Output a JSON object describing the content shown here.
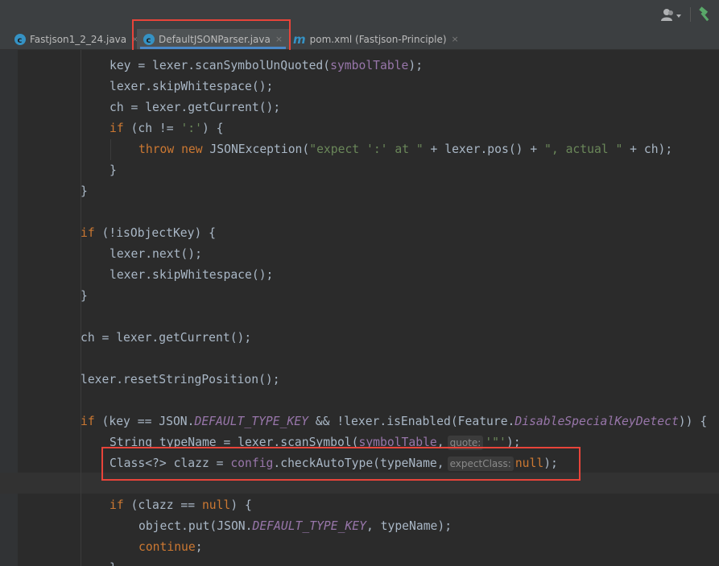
{
  "tabs": [
    {
      "label": "Fastjson1_2_24.java",
      "icon": "class-c-icon",
      "active": false
    },
    {
      "label": "DefaultJSONParser.java",
      "icon": "class-c-icon",
      "active": true
    },
    {
      "label": "pom.xml (Fastjson-Principle)",
      "icon": "maven-m-icon",
      "active": false
    }
  ],
  "close_glyph": "×",
  "toolbar": {
    "user_icon": "user-menu-icon",
    "build_icon": "hammer-icon"
  },
  "colors": {
    "background": "#2b2b2b",
    "keyword": "#cc7832",
    "string": "#6a8759",
    "field": "#9876aa",
    "default_text": "#a9b7c6",
    "highlight_box": "#e8443a",
    "active_tab_underline": "#4a88c7"
  },
  "code": {
    "l1": {
      "a": "key = lexer.scanSymbolUnQuoted(",
      "b": "symbolTable",
      "c": ");"
    },
    "l2": "lexer.skipWhitespace();",
    "l3": "ch = lexer.getCurrent();",
    "l4": {
      "kw": "if",
      "a": " (ch != ",
      "s": "':'",
      "b": ") {"
    },
    "l5": {
      "kw1": "throw",
      "kw2": "new",
      "a": " JSONException(",
      "s1": "\"expect ':' at \"",
      "b": " + lexer.pos() + ",
      "s2": "\", actual \"",
      "c": " + ch);"
    },
    "l6": "}",
    "l7": "}",
    "l8": {
      "kw": "if",
      "a": " (!isObjectKey) {"
    },
    "l9": "lexer.next();",
    "l10": "lexer.skipWhitespace();",
    "l11": "}",
    "l12": "ch = lexer.getCurrent();",
    "l13": "lexer.resetStringPosition();",
    "l14": {
      "kw": "if",
      "a": " (key == JSON.",
      "f": "DEFAULT_TYPE_KEY",
      "b": " && !lexer.isEnabled(Feature.",
      "f2": "DisableSpecialKeyDetect",
      "c": ")) {"
    },
    "l15": {
      "a": "String typeName = lexer.scanSymbol(",
      "f": "symbolTable",
      "b": ",",
      "hint": "quote:",
      "s": "'\"'",
      "c": ");"
    },
    "l16": {
      "a": "Class<?> clazz = ",
      "f": "config",
      "b": ".checkAutoType(typeName,",
      "hint": "expectClass:",
      "kw": "null",
      "c": ");"
    },
    "l18": {
      "kw": "if",
      "a": " (clazz == ",
      "kw2": "null",
      "b": ") {"
    },
    "l19": {
      "a": "object.put(JSON.",
      "f": "DEFAULT_TYPE_KEY",
      "b": ", typeName);"
    },
    "l20": {
      "kw": "continue",
      "a": ";"
    },
    "l21": "}"
  }
}
